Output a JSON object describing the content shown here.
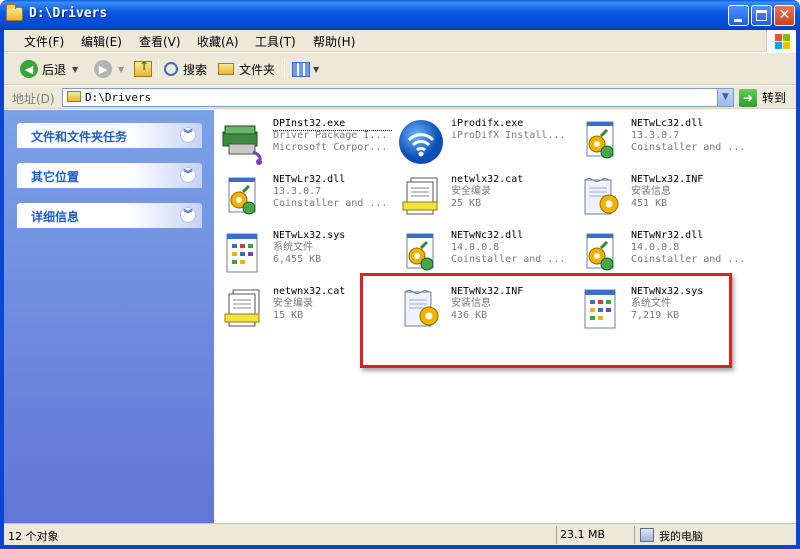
{
  "window": {
    "title": "D:\\Drivers"
  },
  "menu": [
    "文件(F)",
    "编辑(E)",
    "查看(V)",
    "收藏(A)",
    "工具(T)",
    "帮助(H)"
  ],
  "toolbar": {
    "back": "后退",
    "search": "搜索",
    "folders": "文件夹"
  },
  "address": {
    "label": "地址(D)",
    "path": "D:\\Drivers",
    "go": "转到"
  },
  "taskpane": {
    "panels": [
      "文件和文件夹任务",
      "其它位置",
      "详细信息"
    ]
  },
  "files": [
    {
      "name": "DPInst32.exe",
      "line2": "Driver Package I...",
      "line3": "Microsoft Corpor...",
      "icon": "installer-package-icon"
    },
    {
      "name": "iProdifx.exe",
      "line2": "iProDifX Install...",
      "line3": "",
      "icon": "wifi-globe-icon"
    },
    {
      "name": "NETwLc32.dll",
      "line2": "13.3.0.7",
      "line3": "Coinstaller and ...",
      "icon": "dll-gear-icon"
    },
    {
      "name": "NETwLr32.dll",
      "line2": "13.3.0.7",
      "line3": "Coinstaller and ...",
      "icon": "dll-gear-icon"
    },
    {
      "name": "netwlx32.cat",
      "line2": "安全编录",
      "line3": "25 KB",
      "icon": "security-catalog-icon"
    },
    {
      "name": "NETwLx32.INF",
      "line2": "安装信息",
      "line3": "451 KB",
      "icon": "inf-setup-icon"
    },
    {
      "name": "NETwLx32.sys",
      "line2": "系统文件",
      "line3": "6,455 KB",
      "icon": "system-file-icon"
    },
    {
      "name": "NETwNc32.dll",
      "line2": "14.0.0.8",
      "line3": "Coinstaller and ...",
      "icon": "dll-gear-icon"
    },
    {
      "name": "NETwNr32.dll",
      "line2": "14.0.0.8",
      "line3": "Coinstaller and ...",
      "icon": "dll-gear-icon"
    },
    {
      "name": "netwnx32.cat",
      "line2": "安全编录",
      "line3": "15 KB",
      "icon": "security-catalog-icon"
    },
    {
      "name": "NETwNx32.INF",
      "line2": "安装信息",
      "line3": "436 KB",
      "icon": "inf-setup-icon"
    },
    {
      "name": "NETwNx32.sys",
      "line2": "系统文件",
      "line3": "7,219 KB",
      "icon": "system-file-icon"
    }
  ],
  "status": {
    "count": "12 个对象",
    "size": "23.1 MB",
    "location": "我的电脑"
  },
  "colors": {
    "title_blue": "#0858e3",
    "pane_blue": "#6f8be0",
    "highlight_red": "#d42424"
  }
}
